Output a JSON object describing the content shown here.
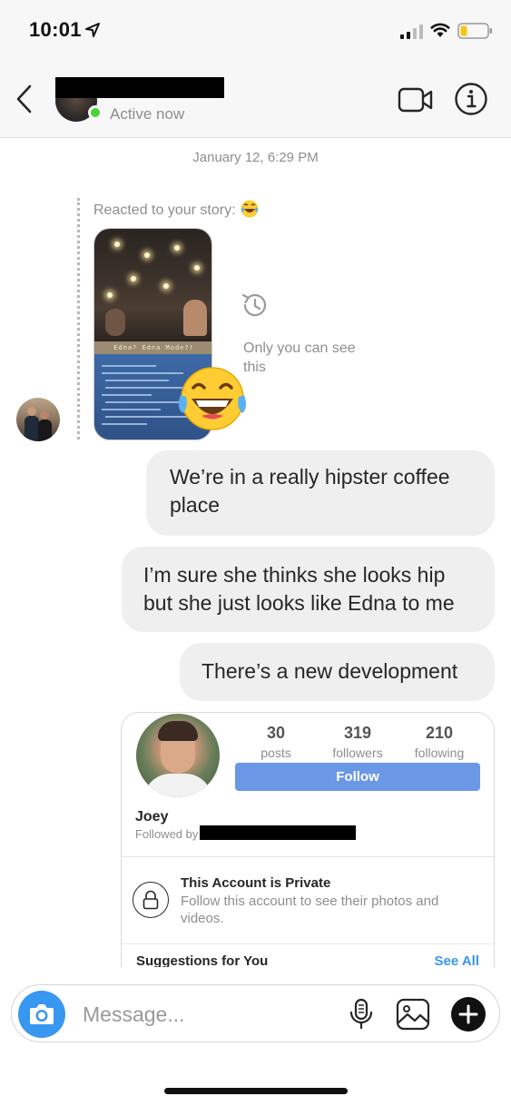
{
  "status_bar": {
    "time": "10:01",
    "icons": [
      "location-arrow-icon",
      "signal-icon",
      "wifi-icon",
      "battery-icon"
    ]
  },
  "header": {
    "contact_status": "Active now",
    "icons": [
      "back-chevron-icon",
      "video-camera-icon",
      "info-icon"
    ]
  },
  "conversation": {
    "date_stamp": "January 12, 6:29 PM",
    "story_reaction": {
      "label": "Reacted to your story:",
      "story_caption": "Edna? Edna Mode?!",
      "privacy_note": "Only you can see this",
      "reaction_emoji": "😂"
    },
    "messages": [
      {
        "text": "We’re in a really hipster coffee place",
        "sender": "me"
      },
      {
        "text": "I’m sure she thinks she looks hip but she just looks like Edna to me",
        "sender": "me"
      },
      {
        "text": "There’s a new development",
        "sender": "me"
      }
    ]
  },
  "profile_card": {
    "name": "Joey",
    "followed_by_label": "Followed by",
    "stats": {
      "posts": {
        "value": "30",
        "label": "posts"
      },
      "followers": {
        "value": "319",
        "label": "followers"
      },
      "following": {
        "value": "210",
        "label": "following"
      }
    },
    "follow_button": "Follow",
    "private_title": "This Account is Private",
    "private_description": "Follow this account to see their photos and videos.",
    "suggestions_label": "Suggestions for You",
    "see_all_label": "See All"
  },
  "composer": {
    "placeholder": "Message...",
    "icons": [
      "camera-icon",
      "microphone-icon",
      "gallery-icon",
      "plus-icon"
    ]
  },
  "colors": {
    "accent_blue": "#3897f0",
    "follow_button": "#6a97e6",
    "online_green": "#4cd137",
    "bubble_gray": "#efefef"
  }
}
